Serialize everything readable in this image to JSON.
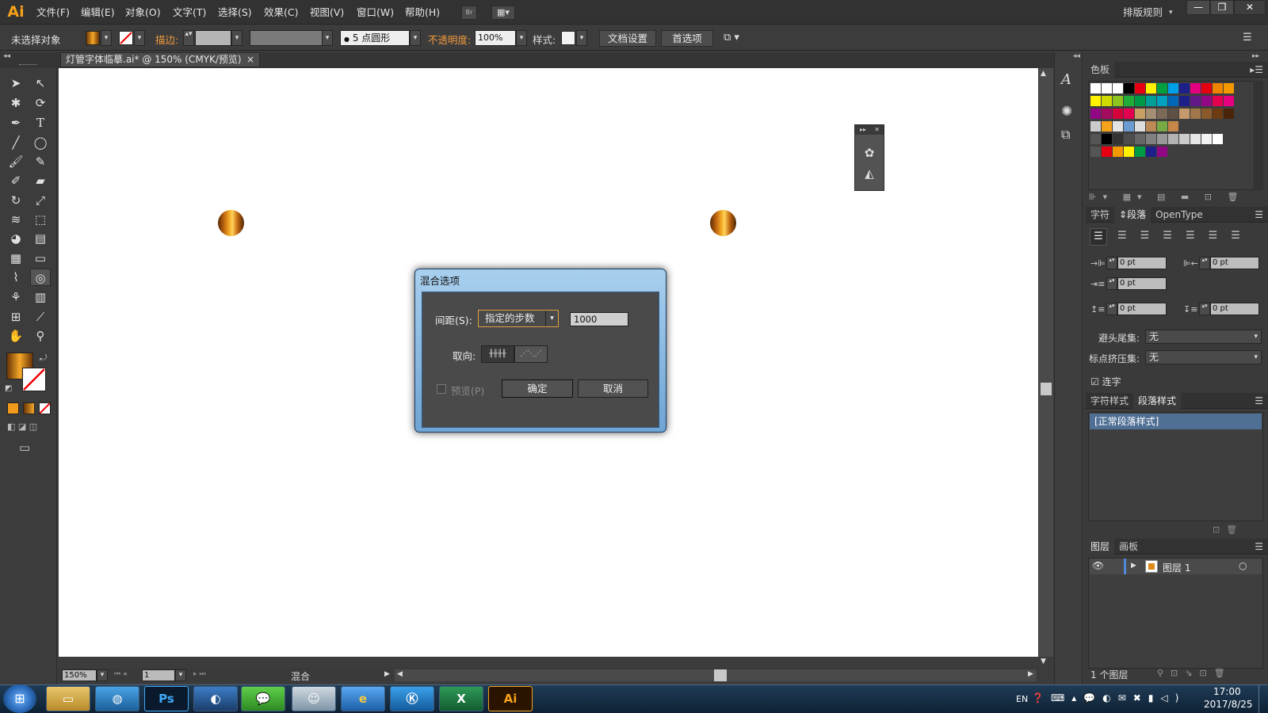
{
  "app": {
    "logo": "Ai",
    "workspace": "排版规则",
    "window_controls": [
      "—",
      "❐",
      "✕"
    ]
  },
  "menus": [
    "文件(F)",
    "编辑(E)",
    "对象(O)",
    "文字(T)",
    "选择(S)",
    "效果(C)",
    "视图(V)",
    "窗口(W)",
    "帮助(H)"
  ],
  "control": {
    "selection": "未选择对象",
    "stroke_label": "描边:",
    "brush": "5 点圆形",
    "opacity_label": "不透明度:",
    "opacity": "100%",
    "style_label": "样式:",
    "doc_setup": "文档设置",
    "prefs": "首选项"
  },
  "document_tab": {
    "title": "灯管字体临摹.ai* @ 150% (CMYK/预览)",
    "close": "×"
  },
  "status": {
    "zoom": "150%",
    "artboard": "1",
    "tool": "混合"
  },
  "dialog": {
    "title": "混合选项",
    "spacing_label": "间距(S):",
    "spacing_value": "指定的步数",
    "steps": "1000",
    "orient_label": "取向:",
    "preview_label": "预览(P)",
    "ok": "确定",
    "cancel": "取消"
  },
  "swatch_panel": {
    "title": "色板"
  },
  "para_panel": {
    "tabs": [
      "字符",
      "段落",
      "OpenType"
    ],
    "fields": [
      "0 pt",
      "0 pt",
      "0 pt",
      "0 pt",
      "0 pt"
    ],
    "kinsoku_label": "避头尾集:",
    "kinsoku_value": "无",
    "mojikumi_label": "标点挤压集:",
    "mojikumi_value": "无",
    "hyphen_label": "连字"
  },
  "style_panel": {
    "tabs": [
      "字符样式",
      "段落样式"
    ],
    "item": "[正常段落样式]"
  },
  "layers_panel": {
    "tabs": [
      "图层",
      "画板"
    ],
    "layer": "图层 1",
    "count": "1 个图层"
  },
  "taskbar": {
    "apps": [
      "Ps",
      "Ai"
    ],
    "lang": "EN",
    "time": "17:00",
    "date": "2017/8/25"
  }
}
